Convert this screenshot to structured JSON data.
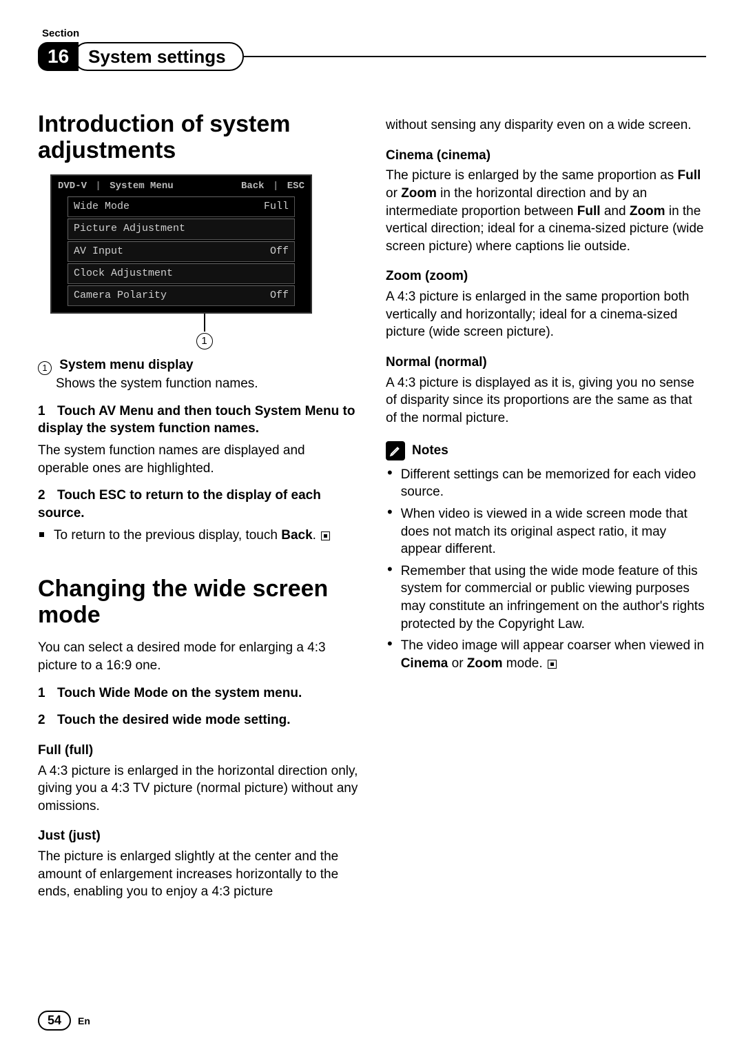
{
  "section_label": "Section",
  "section_number": "16",
  "section_title": "System settings",
  "page_number": "54",
  "lang": "En",
  "left": {
    "h1a": "Introduction of system adjustments",
    "screen": {
      "top_left_a": "DVD-V",
      "top_left_b": "System Menu",
      "top_right_a": "Back",
      "top_right_b": "ESC",
      "rows": [
        {
          "label": "Wide Mode",
          "value": "Full"
        },
        {
          "label": "Picture Adjustment",
          "value": ""
        },
        {
          "label": "AV Input",
          "value": "Off"
        },
        {
          "label": "Clock Adjustment",
          "value": ""
        },
        {
          "label": "Camera Polarity",
          "value": "Off"
        }
      ]
    },
    "callout_num": "1",
    "callout_title": "System menu display",
    "callout_desc": "Shows the system function names.",
    "step1_num": "1",
    "step1_bold": "Touch AV Menu and then touch System Menu to display the system function names.",
    "step1_body": "The system function names are displayed and operable ones are highlighted.",
    "step2_num": "2",
    "step2_bold": "Touch ESC to return to the display of each source.",
    "step2_bullet": "To return to the previous display, touch",
    "step2_back": "Back",
    "h1b": "Changing the wide screen mode",
    "wide_intro": "You can select a desired mode for enlarging a 4:3 picture to a 16:9 one.",
    "wide_step1_num": "1",
    "wide_step1": "Touch Wide Mode on the system menu.",
    "wide_step2_num": "2",
    "wide_step2": "Touch the desired wide mode setting.",
    "full_h": "Full (full)",
    "full_p": "A 4:3 picture is enlarged in the horizontal direction only, giving you a 4:3 TV picture (normal picture) without any omissions.",
    "just_h": "Just (just)",
    "just_p": "The picture is enlarged slightly at the center and the amount of enlargement increases horizontally to the ends, enabling you to enjoy a 4:3 picture"
  },
  "right": {
    "cont": "without sensing any disparity even on a wide screen.",
    "cinema_h": "Cinema (cinema)",
    "cinema_p_a": "The picture is enlarged by the same proportion as ",
    "cinema_b1": "Full",
    "cinema_p_b": " or ",
    "cinema_b2": "Zoom",
    "cinema_p_c": " in the horizontal direction and by an intermediate proportion between ",
    "cinema_b3": "Full",
    "cinema_p_d": " and ",
    "cinema_b4": "Zoom",
    "cinema_p_e": " in the vertical direction; ideal for a cinema-sized picture (wide screen picture) where captions lie outside.",
    "zoom_h": "Zoom (zoom)",
    "zoom_p": "A 4:3 picture is enlarged in the same proportion both vertically and horizontally; ideal for a cinema-sized picture (wide screen picture).",
    "normal_h": "Normal (normal)",
    "normal_p": "A 4:3 picture is displayed as it is, giving you no sense of disparity since its proportions are the same as that of the normal picture.",
    "notes_h": "Notes",
    "note1": "Different settings can be memorized for each video source.",
    "note2": "When video is viewed in a wide screen mode that does not match its original aspect ratio, it may appear different.",
    "note3": "Remember that using the wide mode feature of this system for commercial or public viewing purposes may constitute an infringement on the author's rights protected by the Copyright Law.",
    "note4_a": "The video image will appear coarser when viewed in ",
    "note4_b1": "Cinema",
    "note4_b": " or ",
    "note4_b2": "Zoom",
    "note4_c": " mode."
  }
}
